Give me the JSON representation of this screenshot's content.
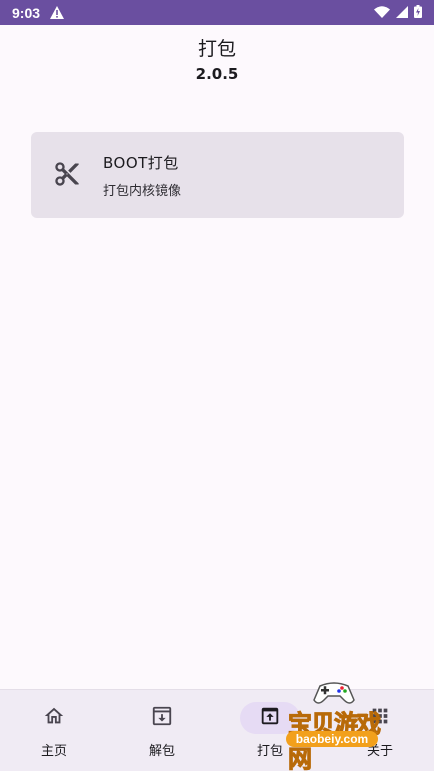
{
  "status_bar": {
    "time": "9:03"
  },
  "header": {
    "title": "打包",
    "version": "2.0.5"
  },
  "cards": [
    {
      "title": "BOOT打包",
      "subtitle": "打包内核镜像",
      "icon": "scissors-icon"
    }
  ],
  "bottom_nav": {
    "items": [
      {
        "label": "主页",
        "icon": "home-icon"
      },
      {
        "label": "解包",
        "icon": "archive-icon"
      },
      {
        "label": "打包",
        "icon": "pack-icon",
        "active": true
      },
      {
        "label": "关于",
        "icon": "grid-icon"
      }
    ]
  },
  "watermark": {
    "text": "宝贝游戏网",
    "url": "baobeiy.com"
  },
  "colors": {
    "status_bar": "#6a4fa0",
    "card_bg": "#e7e1ea",
    "nav_bg": "#f0ebf4",
    "active_pill": "#e6dbf4",
    "watermark": "#f2a01c"
  }
}
